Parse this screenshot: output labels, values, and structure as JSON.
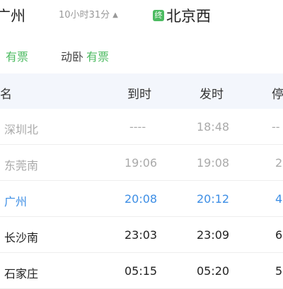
{
  "header": {
    "from_station": "广州",
    "duration": "10小时31分",
    "duration_arrow": "▲",
    "terminal_badge": "终",
    "to_station": "北京西"
  },
  "seats": {
    "seat1_status": "有票",
    "seat2_name": "动卧",
    "seat2_status": "有票"
  },
  "table": {
    "columns": [
      "名",
      "到时",
      "发时",
      "停"
    ],
    "rows": [
      {
        "name": "深圳北",
        "arrive": "----",
        "depart": "18:48",
        "stop": "--",
        "state": "passed"
      },
      {
        "name": "东莞南",
        "arrive": "19:06",
        "depart": "19:08",
        "stop": "2",
        "state": "passed"
      },
      {
        "name": "广州",
        "arrive": "20:08",
        "depart": "20:12",
        "stop": "4",
        "state": "current"
      },
      {
        "name": "长沙南",
        "arrive": "23:03",
        "depart": "23:09",
        "stop": "6",
        "state": "future"
      },
      {
        "name": "石家庄",
        "arrive": "05:15",
        "depart": "05:20",
        "stop": "5",
        "state": "future"
      }
    ]
  },
  "colors": {
    "available_green": "#4cbb61",
    "current_blue": "#3d8ee5",
    "passed_gray": "#aaaaaa",
    "header_bg": "#f3f6fc"
  }
}
